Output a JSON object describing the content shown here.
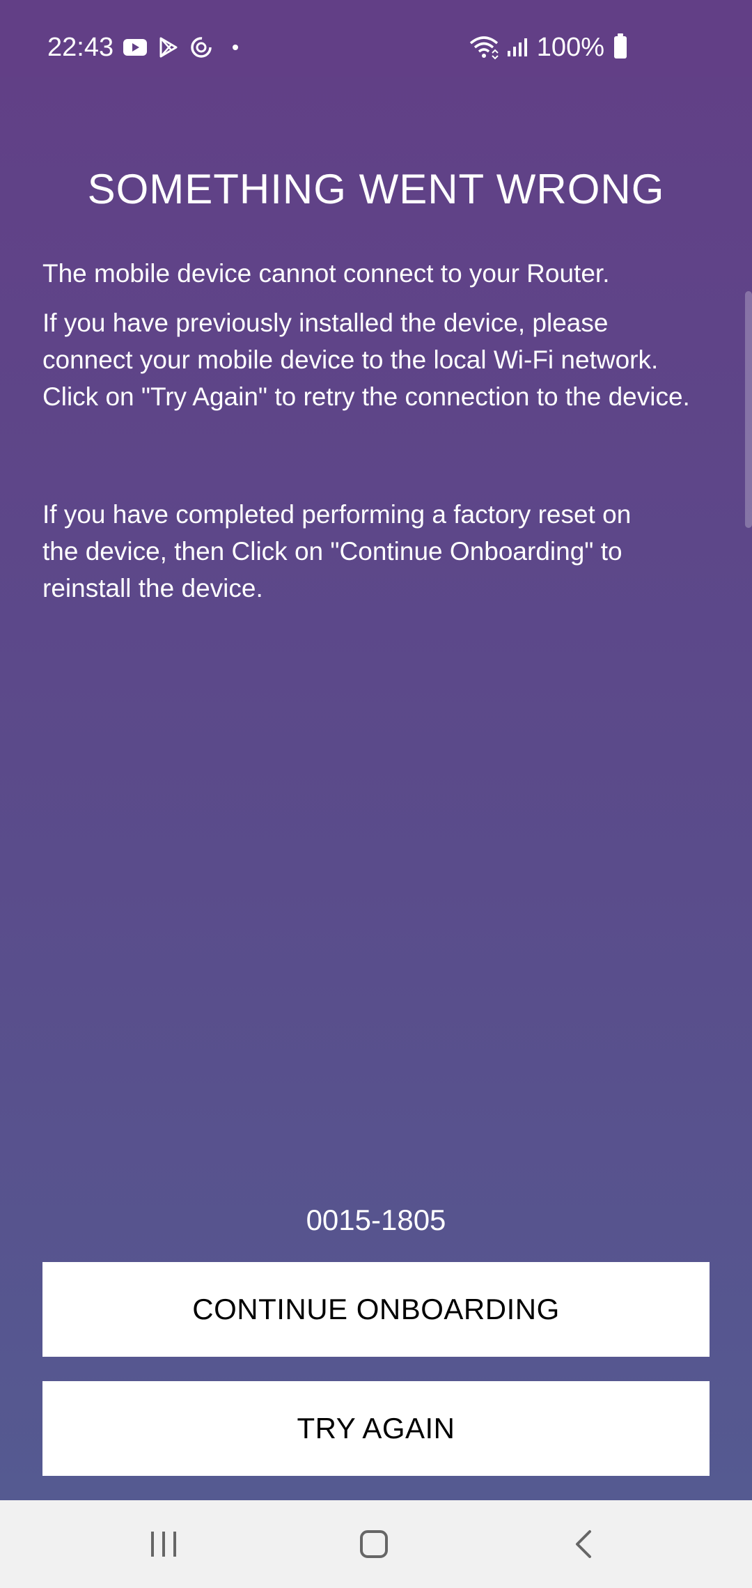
{
  "status_bar": {
    "time": "22:43",
    "battery_percent": "100%",
    "icons": [
      "youtube-icon",
      "play-store-icon",
      "sync-icon",
      "notification-dot-icon",
      "wifi-icon",
      "signal-icon",
      "battery-icon"
    ]
  },
  "content": {
    "title": "SOMETHING WENT WRONG",
    "message_1": "The mobile device cannot connect to your Router.",
    "message_2": "If you have previously installed the device, please connect your mobile device to the local Wi-Fi network. Click on \"Try Again\" to retry the connection to the device.",
    "message_3": "If you have completed performing a factory reset on the device, then Click on \"Continue Onboarding\" to reinstall the device.",
    "code": "0015-1805"
  },
  "buttons": {
    "continue_label": "CONTINUE ONBOARDING",
    "try_again_label": "TRY AGAIN"
  },
  "navigation": {
    "icons": [
      "recents-icon",
      "home-icon",
      "back-icon"
    ]
  },
  "colors": {
    "background_top": "#623f86",
    "background_bottom": "#545c92",
    "button_background": "#ffffff",
    "nav_bar": "#f1f1f1"
  }
}
